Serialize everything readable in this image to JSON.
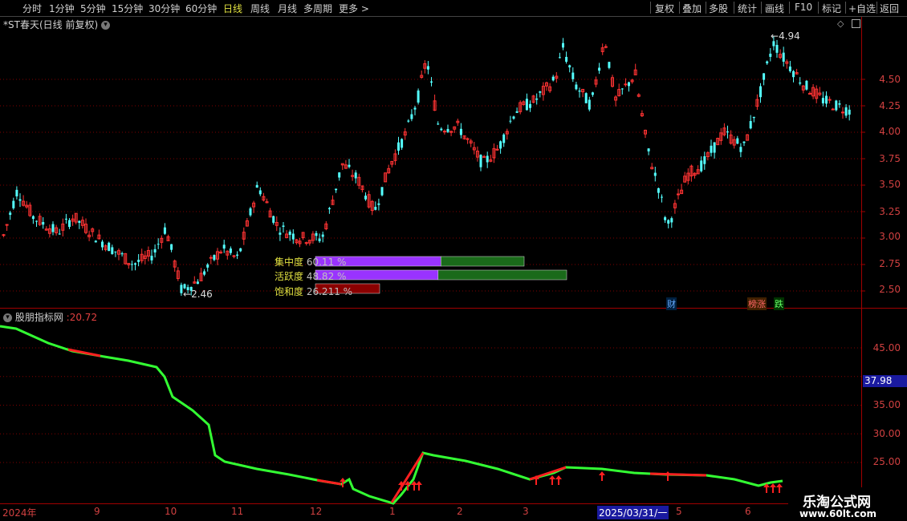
{
  "toolbar": {
    "periods": [
      "分时",
      "1分钟",
      "5分钟",
      "15分钟",
      "30分钟",
      "60分钟",
      "日线",
      "周线",
      "月线",
      "多周期",
      "更多 >"
    ],
    "active_period": "日线",
    "right_buttons": [
      "复权",
      "叠加",
      "多股",
      "统计",
      "画线",
      "F10",
      "标记",
      "+自选",
      "返回"
    ]
  },
  "main_pane": {
    "title": "*ST春天(日线 前复权)",
    "high_label": "4.94",
    "low_label": "2.46",
    "price_ticks": [
      "4.50",
      "4.25",
      "4.00",
      "3.75",
      "3.50",
      "3.25",
      "3.00",
      "2.75",
      "2.50"
    ],
    "flags": {
      "cai": "财",
      "rongzhang": "榜涨",
      "die": "跌"
    }
  },
  "chip_bars": [
    {
      "label": "集中度",
      "value": "60.11 %",
      "percent": 60.11
    },
    {
      "label": "活跃度",
      "value": "48.82 %",
      "percent": 48.82
    },
    {
      "label": "饱和度",
      "value": "26.211 %",
      "percent": 26.211
    }
  ],
  "sub_pane": {
    "title": "股朋指标网",
    "value": "20.72",
    "ticks": [
      "45.00",
      "35.00",
      "30.00",
      "25.00"
    ],
    "current_marker": "37.98"
  },
  "x_axis": {
    "labels": [
      "2024年",
      "9",
      "10",
      "11",
      "12",
      "1",
      "2",
      "3",
      "2025/03/31/一",
      "5",
      "6"
    ]
  },
  "watermark": {
    "line1": "乐淘公式网",
    "line2": "www.60lt.com"
  },
  "colors": {
    "up": "#ff3333",
    "down": "#54ffff",
    "line_green": "#33ff33",
    "line_red": "#ff2020",
    "grid": "#800000"
  },
  "chart_data": {
    "type": "candlestick",
    "ylim": [
      2.4,
      5.0
    ],
    "points": 260
  }
}
